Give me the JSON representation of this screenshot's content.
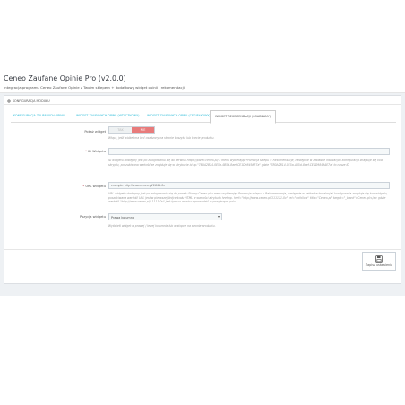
{
  "header": {
    "title": "Ceneo Zaufane Opinie Pro (v2.0.0)",
    "subtitle": "Integracja programu Ceneo Zaufane Opinie z Twoim sklepem + dodatkowy widget opinii i rekomendacji"
  },
  "panel": {
    "heading": "KONFIGURACJA MODUŁU",
    "heading_icon": "cog-icon"
  },
  "tabs": [
    {
      "label": "KONFIGURACJA ZAUFANYCH OPINII",
      "active": false
    },
    {
      "label": "WIDGET ZAUFANYCH OPINII (WTYCZKOWY)",
      "active": false
    },
    {
      "label": "WIDGET ZAUFANYCH OPINII (CEGIEŁKOWY)",
      "active": false
    },
    {
      "label": "WIDGET REKOMENDACJI (OSADZANY)",
      "active": true
    }
  ],
  "form": {
    "show_widget": {
      "label": "Pokaż widget",
      "off": "TAK",
      "on": "NIE",
      "help": "Włącz, jeśli widżet ma być osadzony na stronie koszyka lub karcie produktu."
    },
    "widget_id": {
      "label": "ID Widgetu",
      "required": "*",
      "value": "",
      "help": "ID widgetu dostępny jest po zalogowaniu się do serwisu https://panel.ceneo.pl/ z menu wybierając Promocja sklepu > Rekomendacje, następnie w zakładce Instalacja i konfiguracja znajduje się kod skryptu, poszukiwana wartość ze znajduje się w atrybucie id np.\"7B0A2B14-0E5a-4B5d-8aef-CE1D9849AE7a\" gdzie \"7B0A2B14-0E5a-4B5d-8aef-CE1D9849AE7a\" to nasze ID"
    },
    "widget_url": {
      "label": "URL widgetu",
      "required": "*",
      "placeholder": "example: http://www.ceneo.pl/11111-0v",
      "help": "URL widgetu dostępny jest po zalogowaniu się do panelu Strony Ceneo.pl z menu wybierając Promocja sklepu > Rekomendacje, następnie w zakładce Instalacja i konfiguracja znajduje się kod widgetu, poszukiwana wartość URL jest w pierwszej linijce kodu HTML w wartości atrybutu href np. href=\"http://www.ceneo.pl/111111-0v\" rel=\"nofollow\" title=\"Ceneo.pl\" target=\"_blank\">Ceneo.pl</a> gdzie wartość \"http://www.ceneo.pl/11111-0v\" jest tym co musisz wprowadzić w powyższym polu"
    },
    "position": {
      "label": "Pozycja widgetu",
      "selected": "Prawa kolumna",
      "help": "Wyświetl widget w prawej / lewej kolumnie lub w stopce na stronie produktu."
    }
  },
  "footer": {
    "save_label": "Zapisz ustawienia",
    "save_icon": "floppy-disk-icon"
  },
  "colors": {
    "link": "#25b9d7",
    "toggle_on": "#e87b7b",
    "background": "#eef1f4"
  }
}
